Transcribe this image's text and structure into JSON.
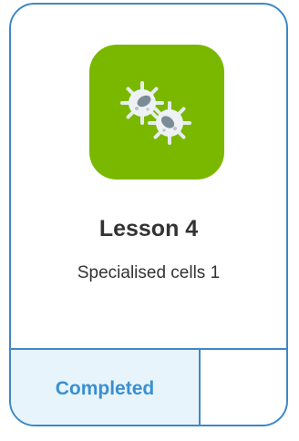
{
  "lesson": {
    "title": "Lesson 4",
    "subtitle": "Specialised cells 1",
    "status": "Completed",
    "icon": "white-blood-cells-icon"
  },
  "colors": {
    "border": "#3f88c5",
    "icon_background": "#7ab800",
    "status_background": "#e8f4fc",
    "status_text": "#3a8fd0",
    "text": "#333333"
  }
}
